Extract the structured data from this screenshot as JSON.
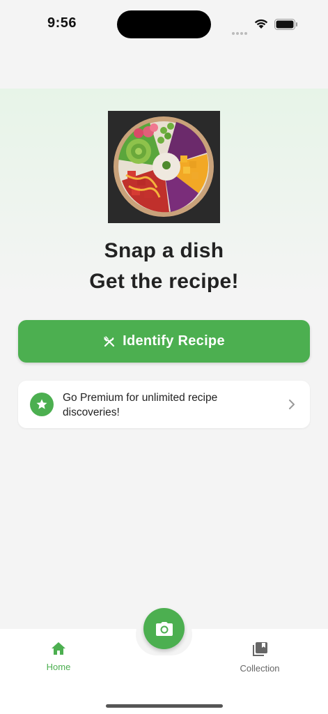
{
  "status_bar": {
    "time": "9:56"
  },
  "main": {
    "headline_line1": "Snap a dish",
    "headline_line2": "Get the recipe!",
    "identify_button_label": "Identify Recipe",
    "premium_banner_text": "Go Premium for unlimited recipe discoveries!"
  },
  "tab_bar": {
    "home_label": "Home",
    "collection_label": "Collection"
  },
  "icons": {
    "identify": "fork-knife-icon",
    "premium": "star-icon",
    "chevron": "chevron-right-icon",
    "home": "home-icon",
    "collection": "collection-icon",
    "camera": "camera-icon"
  },
  "colors": {
    "accent": "#4caf50",
    "background": "#f4f4f4",
    "inactive_tab": "#666666"
  }
}
